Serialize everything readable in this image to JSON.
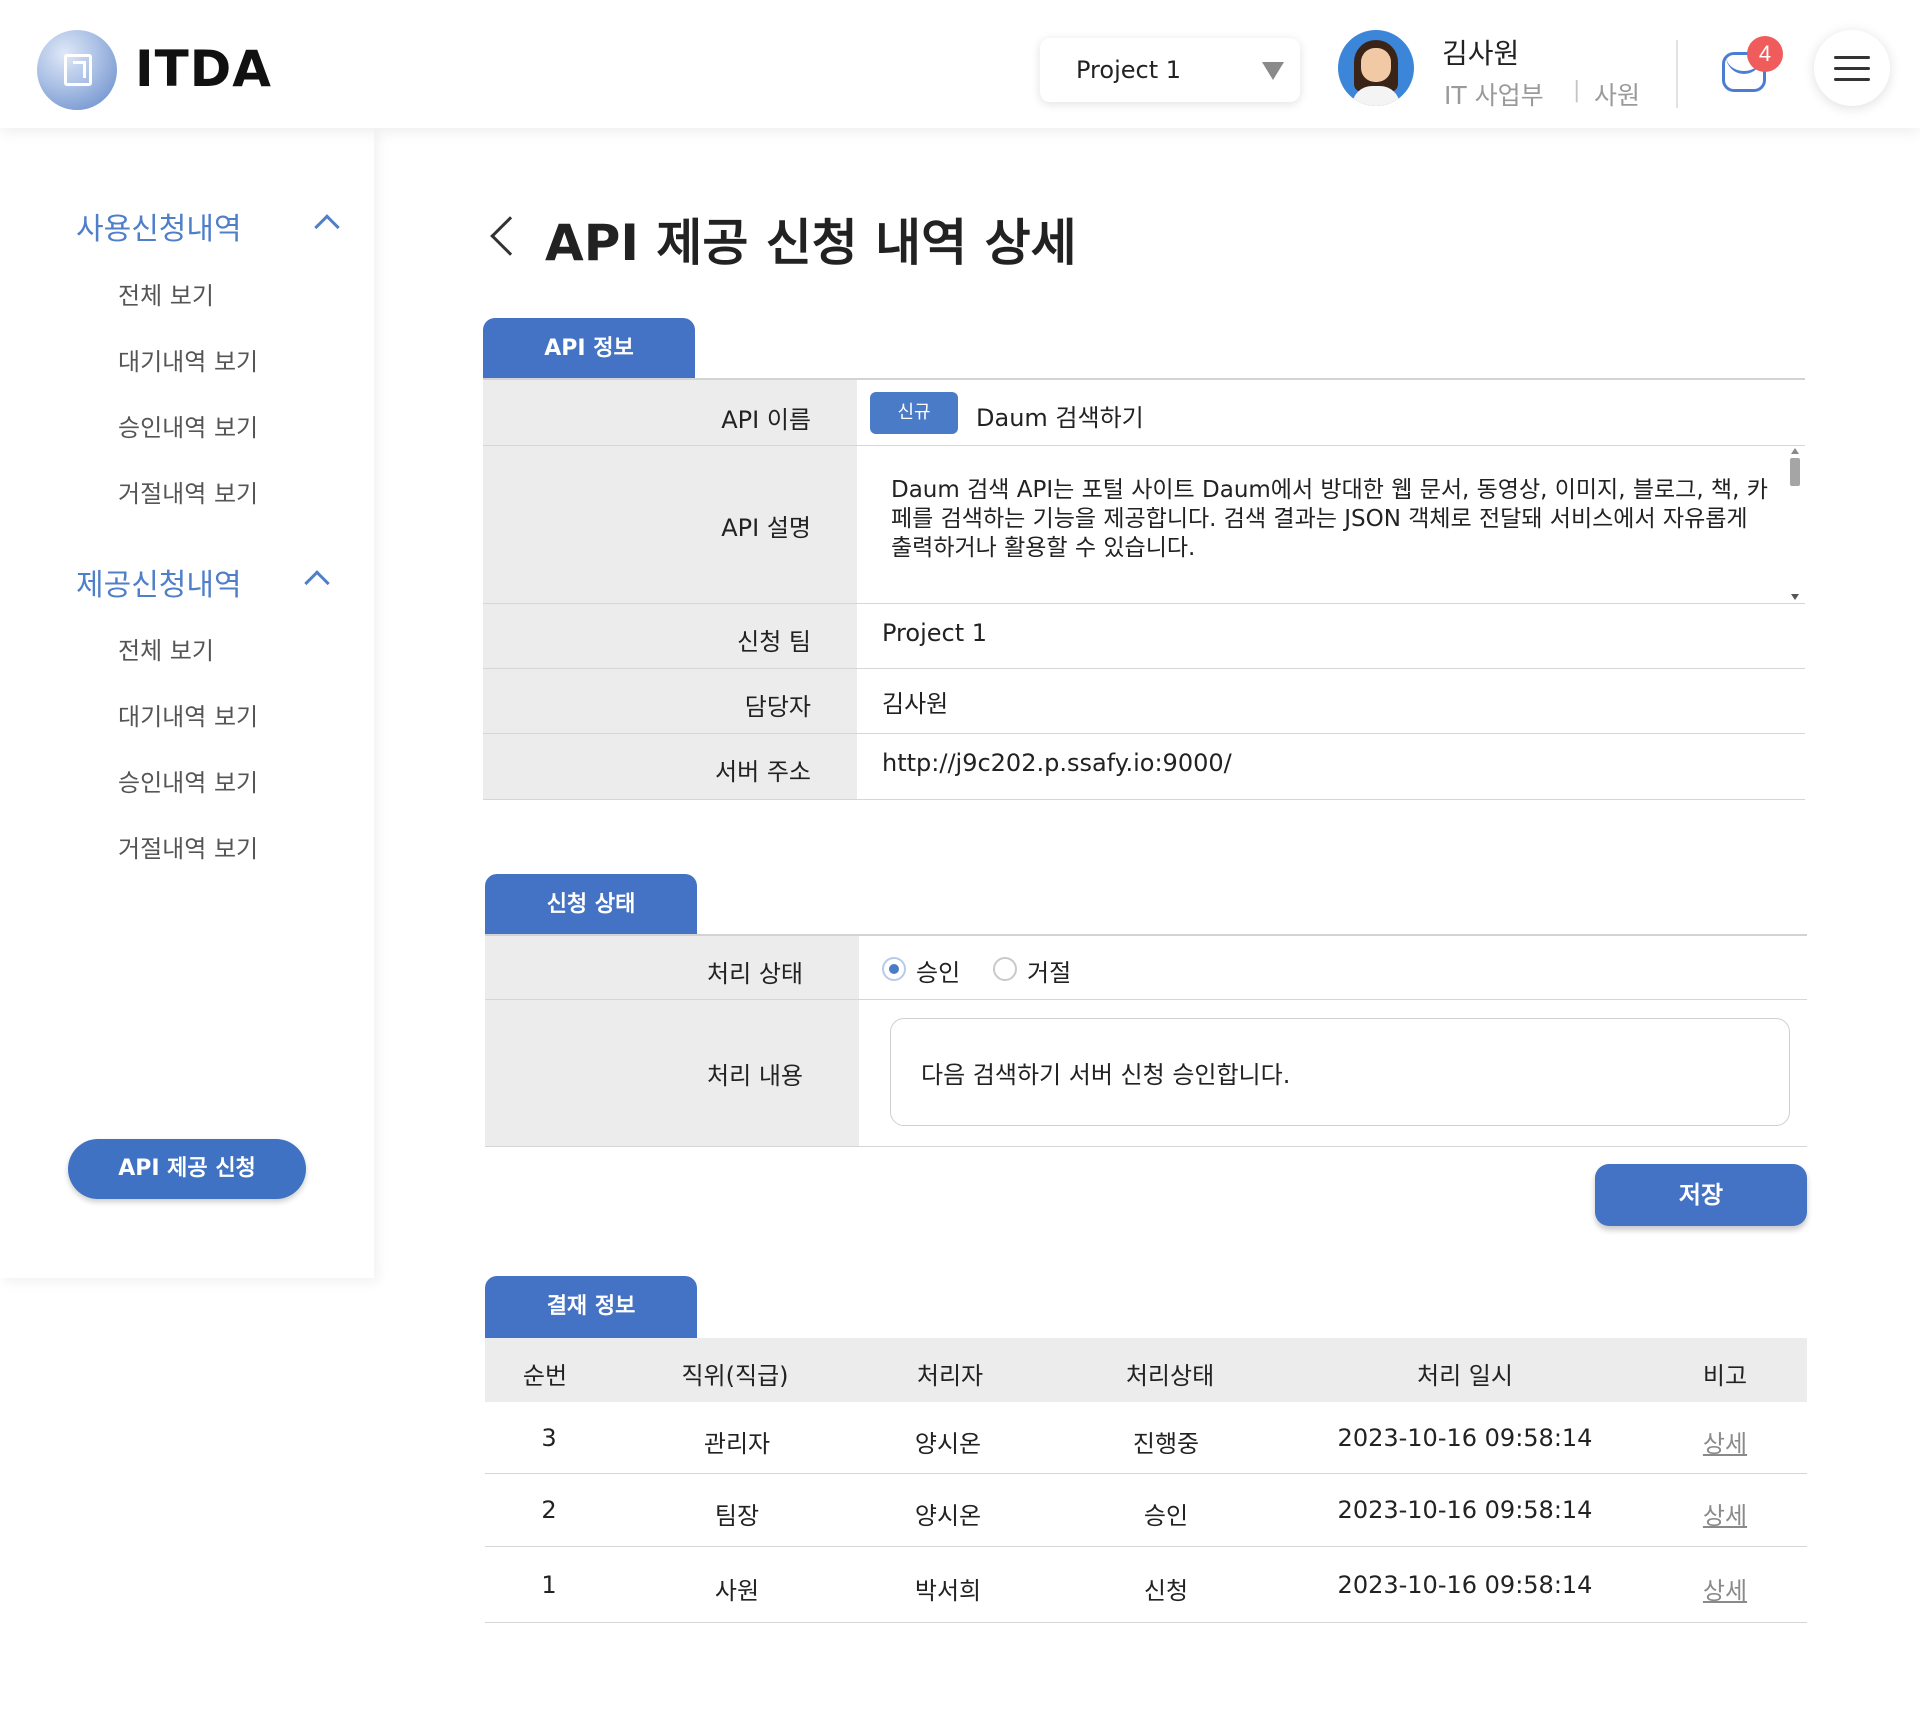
{
  "header": {
    "logo_text": "ITDA",
    "project_select": "Project 1",
    "user": {
      "name": "김사원",
      "dept": "IT 사업부",
      "separator": "|",
      "rank": "사원"
    },
    "notification_count": "4"
  },
  "sidebar": {
    "groups": [
      {
        "label": "사용신청내역",
        "items": [
          "전체 보기",
          "대기내역 보기",
          "승인내역 보기",
          "거절내역 보기"
        ]
      },
      {
        "label": "제공신청내역",
        "items": [
          "전체 보기",
          "대기내역 보기",
          "승인내역 보기",
          "거절내역 보기"
        ]
      }
    ],
    "cta_button": "API 제공 신청"
  },
  "page": {
    "title": "API 제공 신청 내역 상세"
  },
  "api_info": {
    "tab": "API 정보",
    "labels": {
      "name": "API 이름",
      "desc": "API 설명",
      "team": "신청 팀",
      "manager": "담당자",
      "server": "서버 주소"
    },
    "tag": "신규",
    "name": "Daum 검색하기",
    "description": "Daum 검색 API는 포털 사이트 Daum에서 방대한 웹 문서, 동영상, 이미지, 블로그, 책, 카페를 검색하는 기능을 제공합니다. 검색 결과는 JSON 객체로 전달돼 서비스에서 자유롭게 출력하거나 활용할 수 있습니다.",
    "team": "Project 1",
    "manager": "김사원",
    "server": "http://j9c202.p.ssafy.io:9000/"
  },
  "status": {
    "tab": "신청 상태",
    "label_state": "처리 상태",
    "label_content": "처리 내용",
    "option_approve": "승인",
    "option_reject": "거절",
    "selected": "승인",
    "content": "다음 검색하기 서버 신청 승인합니다.",
    "save_label": "저장"
  },
  "approval": {
    "tab": "결재 정보",
    "columns": [
      "순번",
      "직위(직급)",
      "처리자",
      "처리상태",
      "처리 일시",
      "비고"
    ],
    "rows": [
      [
        "3",
        "관리자",
        "양시온",
        "진행중",
        "2023-10-16 09:58:14",
        "상세"
      ],
      [
        "2",
        "팀장",
        "양시온",
        "승인",
        "2023-10-16 09:58:14",
        "상세"
      ],
      [
        "1",
        "사원",
        "박서희",
        "신청",
        "2023-10-16 09:58:14",
        "상세"
      ]
    ]
  },
  "colors": {
    "accent": "#4472c4",
    "sidebar_accent": "#4f7fc9",
    "badge": "#f05b5b",
    "label_bg": "#ececec"
  }
}
